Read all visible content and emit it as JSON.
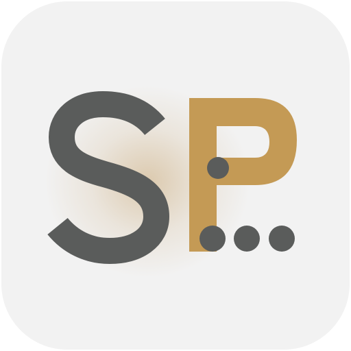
{
  "app_icon": {
    "logo_text": "SP...",
    "colors": {
      "background": "#F2F2F2",
      "glow": "#C9A876",
      "letter_s": "#5A5C5B",
      "letter_p": "#C49A55",
      "dots": "#5A5C5B"
    }
  }
}
